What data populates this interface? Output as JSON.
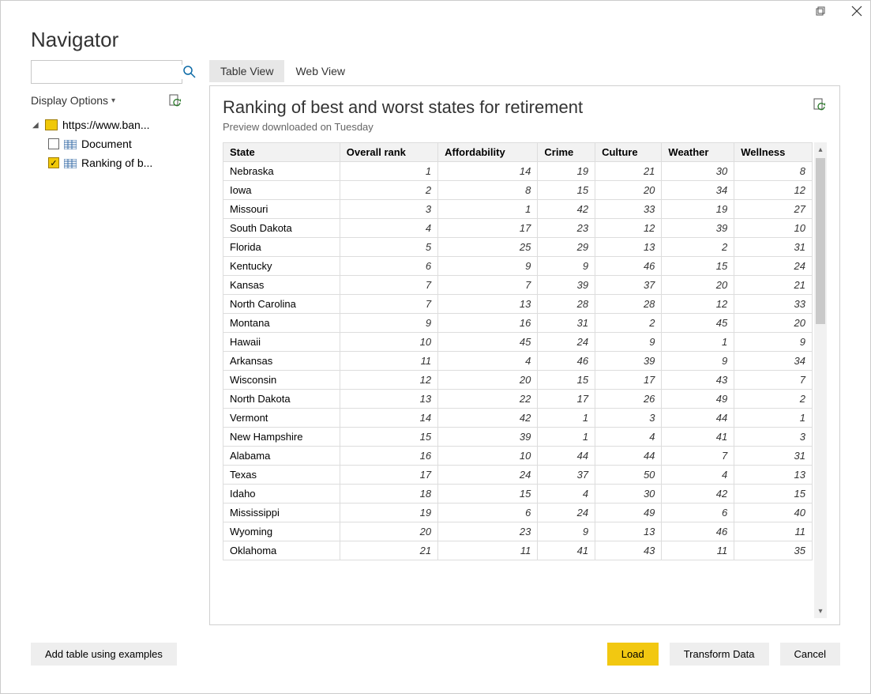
{
  "window": {
    "title": "Navigator"
  },
  "sidebar": {
    "search_placeholder": "",
    "display_options_label": "Display Options",
    "root_label": "https://www.ban...",
    "item_document": "Document",
    "item_ranking": "Ranking of b..."
  },
  "tabs": {
    "table_view": "Table View",
    "web_view": "Web View"
  },
  "preview": {
    "title": "Ranking of best and worst states for retirement",
    "subtitle": "Preview downloaded on Tuesday"
  },
  "table": {
    "columns": [
      "State",
      "Overall rank",
      "Affordability",
      "Crime",
      "Culture",
      "Weather",
      "Wellness"
    ],
    "rows": [
      [
        "Nebraska",
        1,
        14,
        19,
        21,
        30,
        8
      ],
      [
        "Iowa",
        2,
        8,
        15,
        20,
        34,
        12
      ],
      [
        "Missouri",
        3,
        1,
        42,
        33,
        19,
        27
      ],
      [
        "South Dakota",
        4,
        17,
        23,
        12,
        39,
        10
      ],
      [
        "Florida",
        5,
        25,
        29,
        13,
        2,
        31
      ],
      [
        "Kentucky",
        6,
        9,
        9,
        46,
        15,
        24
      ],
      [
        "Kansas",
        7,
        7,
        39,
        37,
        20,
        21
      ],
      [
        "North Carolina",
        7,
        13,
        28,
        28,
        12,
        33
      ],
      [
        "Montana",
        9,
        16,
        31,
        2,
        45,
        20
      ],
      [
        "Hawaii",
        10,
        45,
        24,
        9,
        1,
        9
      ],
      [
        "Arkansas",
        11,
        4,
        46,
        39,
        9,
        34
      ],
      [
        "Wisconsin",
        12,
        20,
        15,
        17,
        43,
        7
      ],
      [
        "North Dakota",
        13,
        22,
        17,
        26,
        49,
        2
      ],
      [
        "Vermont",
        14,
        42,
        1,
        3,
        44,
        1
      ],
      [
        "New Hampshire",
        15,
        39,
        1,
        4,
        41,
        3
      ],
      [
        "Alabama",
        16,
        10,
        44,
        44,
        7,
        31
      ],
      [
        "Texas",
        17,
        24,
        37,
        50,
        4,
        13
      ],
      [
        "Idaho",
        18,
        15,
        4,
        30,
        42,
        15
      ],
      [
        "Mississippi",
        19,
        6,
        24,
        49,
        6,
        40
      ],
      [
        "Wyoming",
        20,
        23,
        9,
        13,
        46,
        11
      ],
      [
        "Oklahoma",
        21,
        11,
        41,
        43,
        11,
        35
      ]
    ]
  },
  "footer": {
    "add_table": "Add table using examples",
    "load": "Load",
    "transform": "Transform Data",
    "cancel": "Cancel"
  }
}
